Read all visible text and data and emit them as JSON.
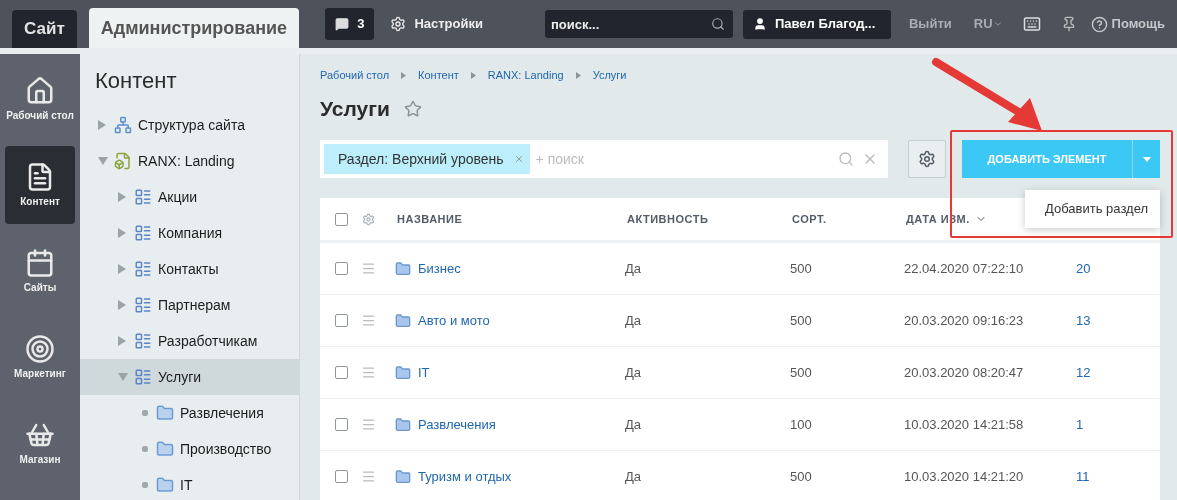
{
  "top_bar": {
    "tabs": [
      {
        "label": "Сайт",
        "selected": false
      },
      {
        "label": "Администрирование",
        "selected": true
      }
    ],
    "notifications": {
      "count": "3"
    },
    "settings": {
      "label": "Настройки"
    },
    "search": {
      "placeholder": "поиск..."
    },
    "user": {
      "name": "Павел Благод..."
    },
    "logout": {
      "label": "Выйти"
    },
    "language": {
      "label": "RU"
    },
    "help": {
      "label": "Помощь"
    }
  },
  "nav": [
    {
      "kind": "home",
      "label": "Рабочий стол",
      "selected": false
    },
    {
      "kind": "content",
      "label": "Контент",
      "selected": true
    },
    {
      "kind": "calendar",
      "label": "Сайты",
      "selected": false
    },
    {
      "kind": "target",
      "label": "Маркетинг",
      "selected": false
    },
    {
      "kind": "basket",
      "label": "Магазин",
      "selected": false
    }
  ],
  "tree": {
    "title": "Контент",
    "items": [
      {
        "kind": "structure",
        "label": "Структура сайта",
        "expanded": false,
        "selected": false
      },
      {
        "kind": "type",
        "label": "RANX: Landing",
        "expanded": true,
        "selected": false,
        "children": [
          {
            "kind": "iblock",
            "label": "Акции",
            "expanded": false,
            "selected": false
          },
          {
            "kind": "iblock",
            "label": "Компания",
            "expanded": false,
            "selected": false
          },
          {
            "kind": "iblock",
            "label": "Контакты",
            "expanded": false,
            "selected": false
          },
          {
            "kind": "iblock",
            "label": "Партнерам",
            "expanded": false,
            "selected": false
          },
          {
            "kind": "iblock",
            "label": "Разработчикам",
            "expanded": false,
            "selected": false
          },
          {
            "kind": "iblock",
            "label": "Услуги",
            "expanded": true,
            "selected": true,
            "children": [
              {
                "kind": "section",
                "label": "Развлечения",
                "selected": false
              },
              {
                "kind": "section",
                "label": "Производство",
                "selected": false
              },
              {
                "kind": "section",
                "label": "IT",
                "selected": false
              }
            ]
          }
        ]
      }
    ]
  },
  "breadcrumbs": [
    "Рабочий стол",
    "Контент",
    "RANX: Landing",
    "Услуги"
  ],
  "title": "Услуги",
  "filter": {
    "chip": "Раздел: Верхний уровень",
    "placeholder": "+ поиск"
  },
  "add_button": {
    "label": "ДОБАВИТЬ ЭЛЕМЕНТ"
  },
  "add_menu": [
    "Добавить раздел"
  ],
  "table": {
    "all_checked": false,
    "columns": [
      {
        "label": "НАЗВАНИЕ",
        "sorted": false
      },
      {
        "label": "АКТИВНОСТЬ",
        "sorted": false
      },
      {
        "label": "СОРТ.",
        "sorted": false
      },
      {
        "label": "ДАТА ИЗМ.",
        "sorted": true
      }
    ],
    "rows": [
      {
        "checked": false,
        "name": "Бизнес",
        "active": "Да",
        "sort": "500",
        "date": "22.04.2020 07:22:10",
        "column_6": "20"
      },
      {
        "checked": false,
        "name": "Авто и мото",
        "active": "Да",
        "sort": "500",
        "date": "20.03.2020 09:16:23",
        "column_6": "13"
      },
      {
        "checked": false,
        "name": "IT",
        "active": "Да",
        "sort": "500",
        "date": "20.03.2020 08:20:47",
        "column_6": "12"
      },
      {
        "checked": false,
        "name": "Развлечения",
        "active": "Да",
        "sort": "100",
        "date": "10.03.2020 14:21:58",
        "column_6": "1"
      },
      {
        "checked": false,
        "name": "Туризм и отдых",
        "active": "Да",
        "sort": "500",
        "date": "10.03.2020 14:21:20",
        "column_6": "11"
      }
    ]
  }
}
